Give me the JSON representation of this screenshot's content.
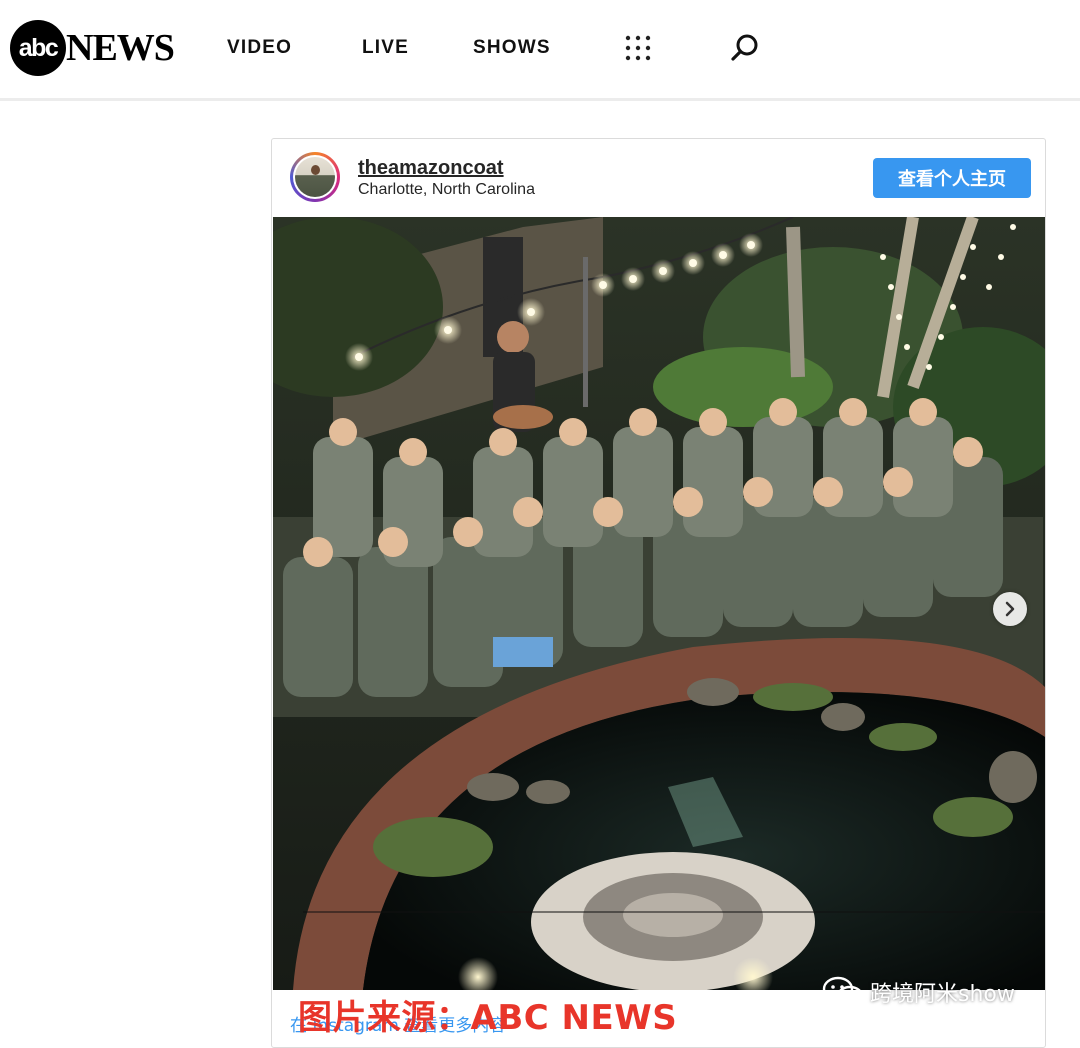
{
  "header": {
    "logo_abc": "abc",
    "logo_news": "NEWS",
    "nav": [
      {
        "label": "VIDEO"
      },
      {
        "label": "LIVE"
      },
      {
        "label": "SHOWS"
      }
    ],
    "icons": {
      "menu": "grid-dots-icon",
      "search": "search-icon"
    }
  },
  "post": {
    "username": "theamazoncoat",
    "location": "Charlotte, North Carolina",
    "profile_button": "查看个人主页",
    "view_more": "在 Instagram 查看更多内容",
    "icons": {
      "next": "chevron-right-icon"
    }
  },
  "overlay": {
    "caption": "图片来源：ABC NEWS",
    "watermark": "跨境阿米show"
  },
  "colors": {
    "accent": "#3897f0",
    "caption_red": "#e8352a",
    "header_border": "#ececec"
  }
}
